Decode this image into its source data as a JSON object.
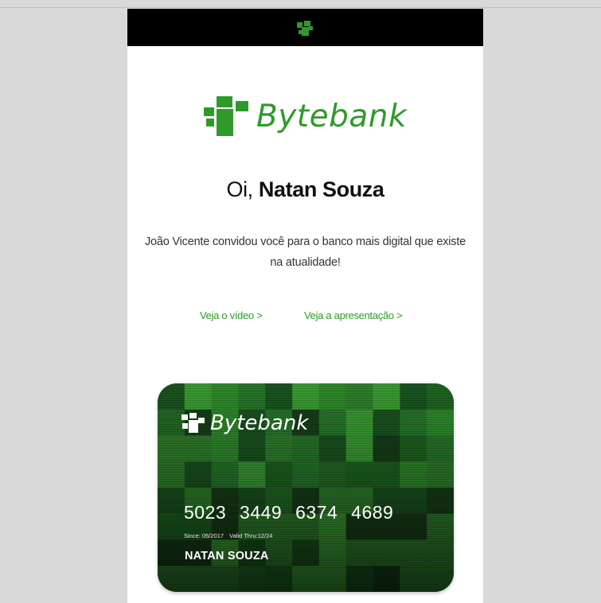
{
  "brand": {
    "name": "Bytebank",
    "color": "#2f9a2a"
  },
  "header": {
    "icon": "bytebank-logo-icon"
  },
  "greeting": {
    "prefix": "Oi,",
    "name": "Natan Souza"
  },
  "invite": {
    "line1": "João Vicente convidou você para o banco mais digital que existe",
    "line2": "na atualidade!"
  },
  "links": {
    "video": "Veja o vídeo >",
    "presentation": "Veja a apresentação >"
  },
  "card": {
    "brand": "Bytebank",
    "number": "5023 3449 6374 4689",
    "since": "Since: 05/2017",
    "valid_thru": "Valid Thru:12/24",
    "holder": "NATAN SOUZA"
  }
}
